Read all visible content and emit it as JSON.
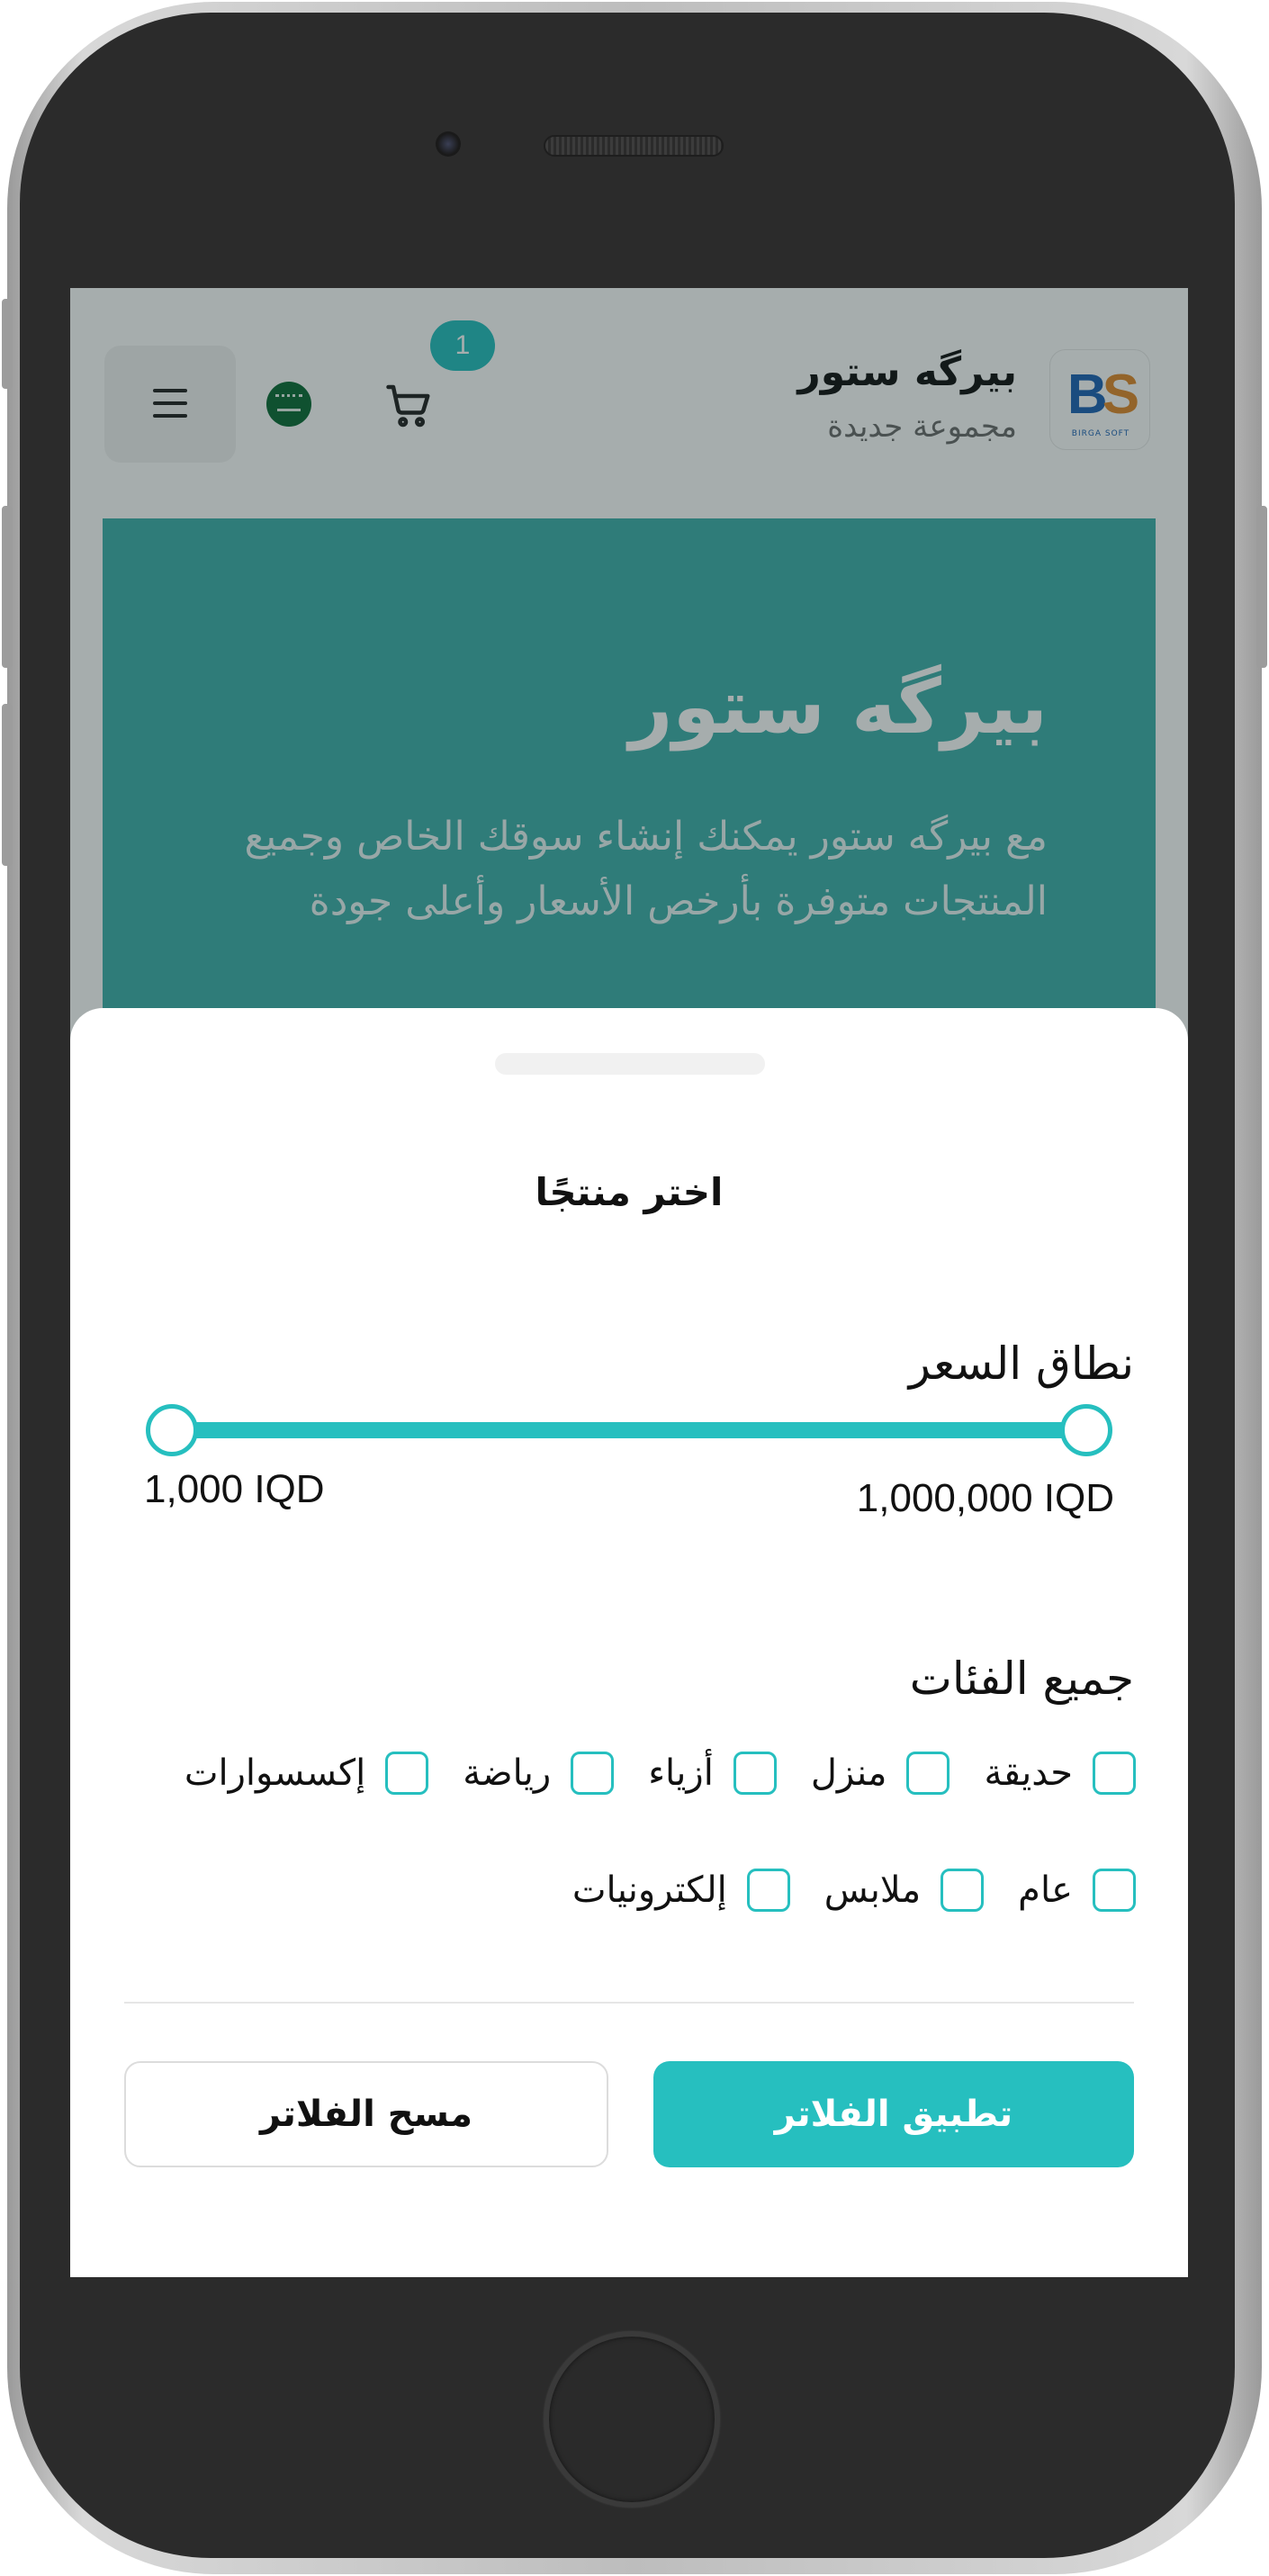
{
  "header": {
    "store_name": "بيرگه ستور",
    "store_subtitle": "مجموعة جديدة",
    "cart_count": "1",
    "logo_text": "BS",
    "logo_sub": "BIRGA SOFT"
  },
  "hero": {
    "title": "بيرگه ستور",
    "description": "مع بيرگه ستور يمكنك إنشاء سوقك الخاص وجميع المنتجات متوفرة بأرخص الأسعار وأعلى جودة"
  },
  "filter_sheet": {
    "title": "اختر منتجًا",
    "price_range": {
      "label": "نطاق السعر",
      "min_label": "1,000 IQD",
      "max_label": "1,000,000 IQD",
      "min_value": 1000,
      "max_value": 1000000
    },
    "categories": {
      "label": "جميع الفئات",
      "row1": [
        "حديقة",
        "منزل",
        "أزياء",
        "رياضة",
        "إكسسوارات"
      ],
      "row2": [
        "عام",
        "ملابس",
        "إلكترونيات"
      ]
    },
    "apply_label": "تطبيق الفلاتر",
    "clear_label": "مسح الفلاتر"
  },
  "colors": {
    "accent": "#26bfbf",
    "hero_bg": "#3fb0ab"
  }
}
